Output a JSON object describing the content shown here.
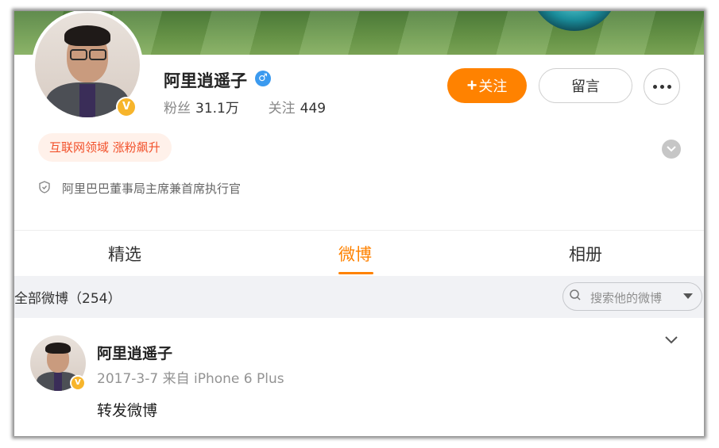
{
  "profile": {
    "name": "阿里逍遥子",
    "gender_symbol": "♂",
    "verified_symbol": "V",
    "fans_label": "粉丝",
    "fans_value": "31.1万",
    "following_label": "关注",
    "following_value": "449",
    "follow_button": "关注",
    "follow_plus": "+",
    "message_button": "留言",
    "tag": "互联网领域 涨粉飙升",
    "job": "阿里巴巴董事局主席兼首席执行官"
  },
  "tabs": [
    {
      "label": "精选",
      "active": false
    },
    {
      "label": "微博",
      "active": true
    },
    {
      "label": "相册",
      "active": false
    }
  ],
  "filter": {
    "count_text": "全部微博（254）",
    "search_placeholder": "搜索他的微博"
  },
  "post": {
    "author": "阿里逍遥子",
    "meta": "2017-3-7  来自 iPhone 6 Plus",
    "text": "转发微博"
  },
  "colors": {
    "accent": "#ff8200",
    "verified": "#f7b52c",
    "gender": "#3b9aef",
    "tag_text": "#f2512b",
    "tag_bg": "#fff1ea"
  },
  "icons": {
    "more": "more-dots-icon",
    "expand": "chevron-down-icon",
    "job": "shield-icon",
    "search": "search-icon"
  }
}
